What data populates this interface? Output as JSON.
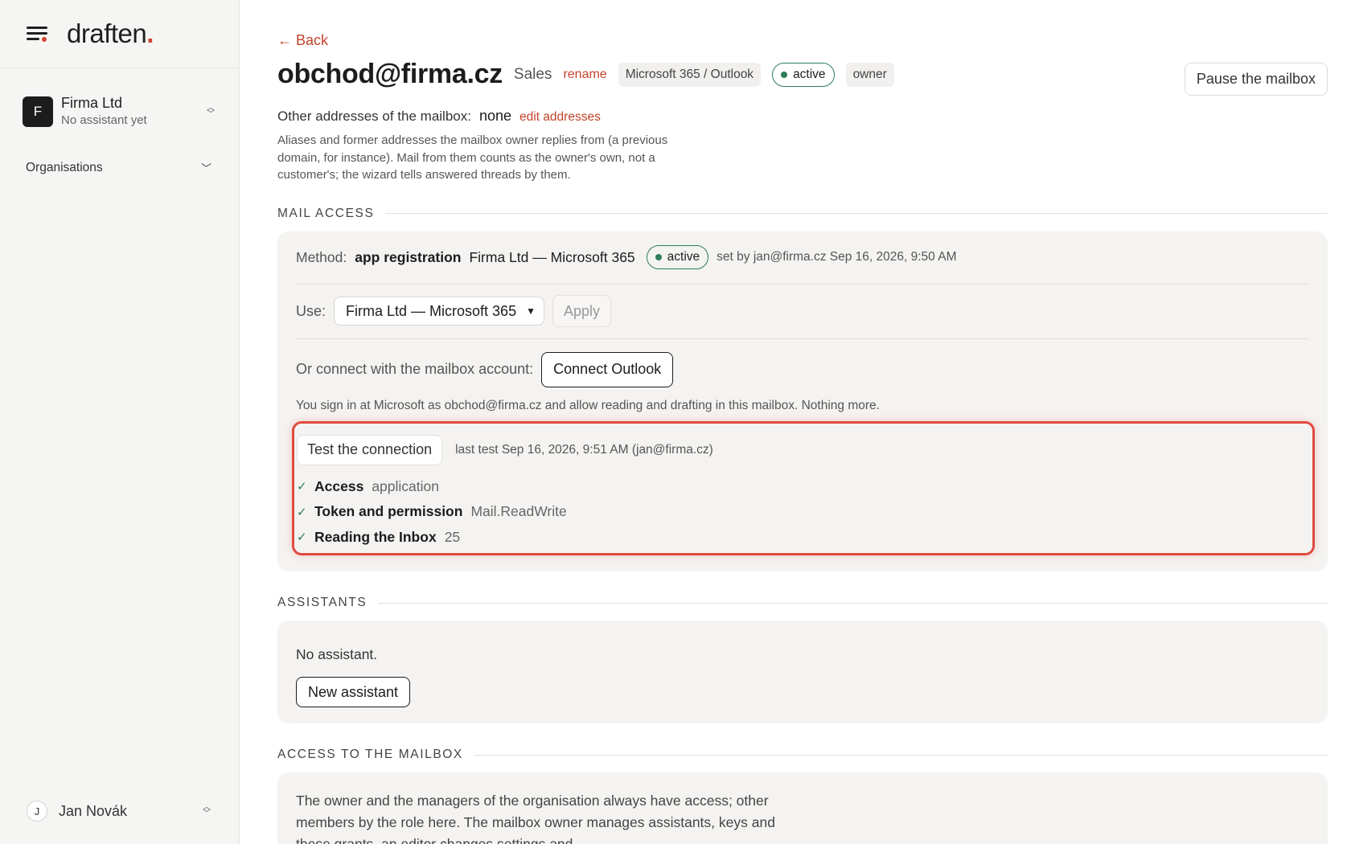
{
  "brand": {
    "name": "draften",
    "dot": "."
  },
  "sidebar": {
    "org": {
      "initial": "F",
      "name": "Firma Ltd",
      "subtitle": "No assistant yet"
    },
    "organisations_label": "Organisations",
    "user": {
      "initial": "J",
      "name": "Jan Novák"
    }
  },
  "header": {
    "back": "← Back",
    "title": "obchod@firma.cz",
    "team": "Sales",
    "rename": "rename",
    "provider_chip": "Microsoft 365 / Outlook",
    "status": "active",
    "role_chip": "owner",
    "pause_button": "Pause the mailbox"
  },
  "other_addresses": {
    "label": "Other addresses of the mailbox:",
    "value": "none",
    "edit": "edit addresses",
    "description": "Aliases and former addresses the mailbox owner replies from (a previous domain, for instance). Mail from them counts as the owner's own, not a customer's; the wizard tells answered threads by them."
  },
  "mail_access": {
    "section_title": "MAIL ACCESS",
    "method_label": "Method:",
    "method_value": "app registration",
    "method_app": "Firma Ltd — Microsoft 365",
    "status": "active",
    "set_by": "set by jan@firma.cz Sep 16, 2026, 9:50 AM",
    "use_label": "Use:",
    "use_selected": "Firma Ltd — Microsoft 365",
    "apply": "Apply",
    "connect_label": "Or connect with the mailbox account:",
    "connect_button": "Connect Outlook",
    "sign_note": "You sign in at Microsoft as obchod@firma.cz and allow reading and drafting in this mailbox. Nothing more.",
    "test_button": "Test the connection",
    "last_test": "last test Sep 16, 2026, 9:51 AM (jan@firma.cz)",
    "checks": [
      {
        "mark": "✓",
        "name": "Access",
        "value": "application"
      },
      {
        "mark": "✓",
        "name": "Token and permission",
        "value": "Mail.ReadWrite"
      },
      {
        "mark": "✓",
        "name": "Reading the Inbox",
        "value": "25"
      }
    ]
  },
  "assistants": {
    "section_title": "ASSISTANTS",
    "empty": "No assistant.",
    "new_button": "New assistant"
  },
  "access": {
    "section_title": "ACCESS TO THE MAILBOX",
    "text": "The owner and the managers of the organisation always have access; other members by the role here. The mailbox owner manages assistants, keys and these grants, an editor changes settings and"
  },
  "colors": {
    "accent": "#c4432c",
    "active_green": "#2e7d57",
    "highlight": "#e04a3f"
  }
}
